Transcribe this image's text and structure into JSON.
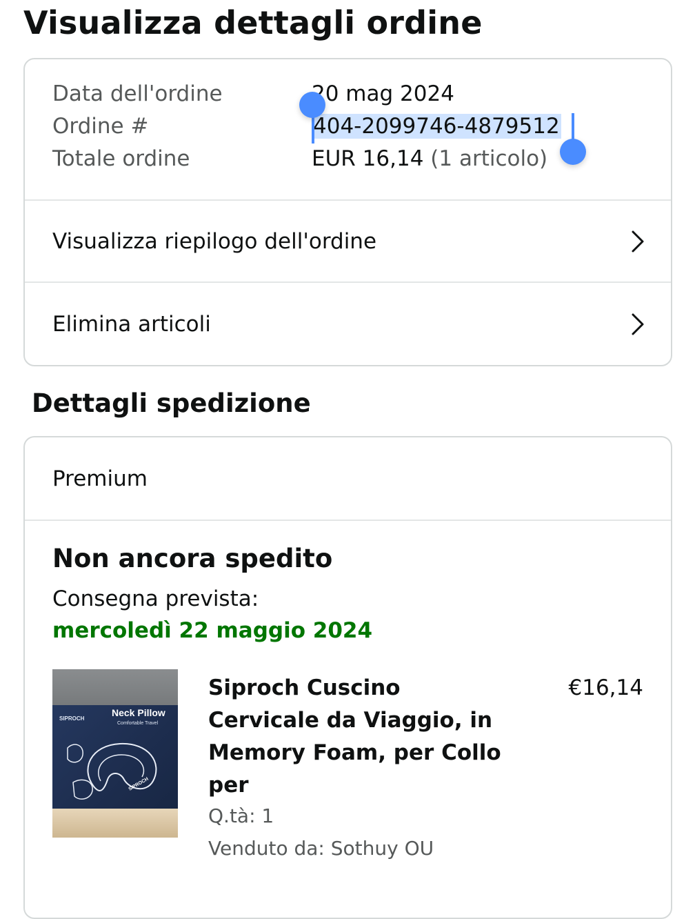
{
  "page": {
    "title": "Visualizza dettagli ordine"
  },
  "order": {
    "date_label": "Data dell'ordine",
    "date_value": "20 mag 2024",
    "number_label": "Ordine #",
    "number_value": "404-2099746-4879512",
    "total_label": "Totale ordine",
    "total_value": "EUR 16,14",
    "total_items": "(1 articolo)"
  },
  "actions": [
    {
      "label": "Visualizza riepilogo dell'ordine",
      "icon": "chevron-right-icon"
    },
    {
      "label": "Elimina articoli",
      "icon": "chevron-right-icon"
    }
  ],
  "shipping": {
    "section_title": "Dettagli spedizione",
    "method": "Premium",
    "status": "Non ancora spedito",
    "delivery_label": "Consegna prevista:",
    "delivery_date": "mercoledì 22 maggio 2024",
    "delivery_color": "#007600"
  },
  "product": {
    "title": "Siproch Cuscino Cervicale da Viaggio, in Memory Foam, per Collo per",
    "price": "€16,14",
    "qty": "Q.tà: 1",
    "seller": "Venduto da: Sothuy OU",
    "image_brand": "SIPROCH",
    "image_heading": "Neck Pillow",
    "image_subheading": "Comfortable Travel"
  },
  "selection": {
    "color": "#4a8cff",
    "highlight": "#cfe3ff"
  }
}
